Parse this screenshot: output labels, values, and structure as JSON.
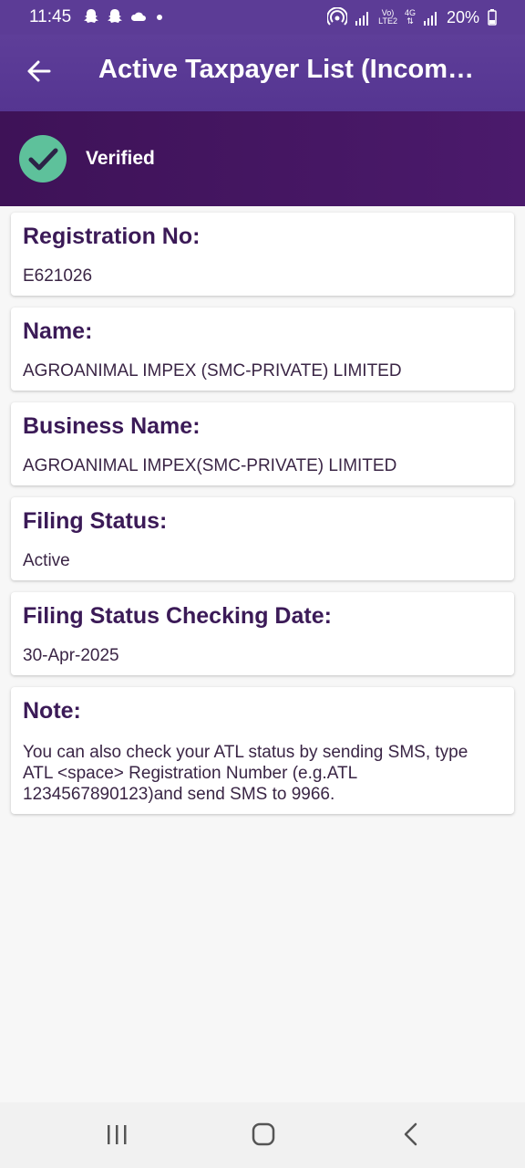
{
  "status_bar": {
    "time": "11:45",
    "battery": "20%",
    "volte_label_top": "Vo)",
    "volte_label_bottom": "LTE2",
    "network_label": "4G"
  },
  "app_bar": {
    "title": "Active Taxpayer List (Income Tax)"
  },
  "banner": {
    "status_label": "Verified",
    "accent_color": "#5ec19b"
  },
  "cards": [
    {
      "heading": "Registration No:",
      "value": "E621026"
    },
    {
      "heading": "Name:",
      "value": "AGROANIMAL IMPEX (SMC-PRIVATE) LIMITED"
    },
    {
      "heading": "Business Name:",
      "value": "AGROANIMAL IMPEX(SMC-PRIVATE) LIMITED"
    },
    {
      "heading": "Filing Status:",
      "value": "Active"
    },
    {
      "heading": "Filing Status Checking Date:",
      "value": "30-Apr-2025"
    },
    {
      "heading": "Note:",
      "value": "You can also check your ATL status by sending SMS, type ATL <space> Registration Number (e.g.ATL 1234567890123)and send SMS to 9966."
    }
  ],
  "nav_bar": {
    "icons": [
      "recent-apps-icon",
      "home-icon",
      "back-icon"
    ]
  }
}
